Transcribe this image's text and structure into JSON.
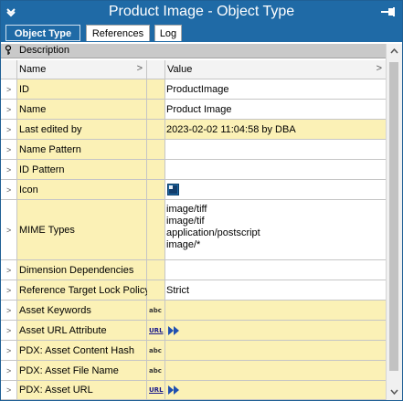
{
  "window": {
    "title": "Product Image - Object Type"
  },
  "tabs": [
    {
      "label": "Object Type",
      "active": true
    },
    {
      "label": "References",
      "active": false
    },
    {
      "label": "Log",
      "active": false
    }
  ],
  "section": {
    "label": "Description"
  },
  "columns": {
    "name": "Name",
    "value": "Value"
  },
  "rows": [
    {
      "name": "ID",
      "value": "ProductImage",
      "type_badge": "",
      "action": ""
    },
    {
      "name": "Name",
      "value": "Product Image",
      "type_badge": "",
      "action": ""
    },
    {
      "name": "Last edited by",
      "value": "2023-02-02 11:04:58 by DBA",
      "type_badge": "",
      "action": ""
    },
    {
      "name": "Name Pattern",
      "value": "",
      "type_badge": "",
      "action": ""
    },
    {
      "name": "ID Pattern",
      "value": "",
      "type_badge": "",
      "action": ""
    },
    {
      "name": "Icon",
      "value": "",
      "type_badge": "",
      "action": "icon"
    },
    {
      "name": "MIME Types",
      "value_lines": [
        "image/tiff",
        "image/tif",
        "application/postscript",
        "image/*"
      ],
      "type_badge": "",
      "action": ""
    },
    {
      "name": "Dimension Dependencies",
      "value": "",
      "type_badge": "",
      "action": ""
    },
    {
      "name": "Reference Target Lock Policy",
      "value": "Strict",
      "type_badge": "",
      "action": ""
    },
    {
      "name": "Asset Keywords",
      "value": "",
      "type_badge": "abc",
      "action": ""
    },
    {
      "name": "Asset URL Attribute",
      "value": "",
      "type_badge": "URL",
      "action": "play"
    },
    {
      "name": "PDX: Asset Content Hash",
      "value": "",
      "type_badge": "abc",
      "action": ""
    },
    {
      "name": "PDX: Asset File Name",
      "value": "",
      "type_badge": "abc",
      "action": ""
    },
    {
      "name": "PDX: Asset URL",
      "value": "",
      "type_badge": "URL",
      "action": "play"
    }
  ],
  "icons": {
    "title_chevron": "chevron-down-icon",
    "title_pin": "pin-icon",
    "section_key": "key-icon",
    "row_expand": "chevron-right-icon",
    "play": "play-icon"
  },
  "colors": {
    "titlebar": "#1f6aa6",
    "row_fill": "#fbf1b6",
    "grid": "#c5c5c5"
  }
}
